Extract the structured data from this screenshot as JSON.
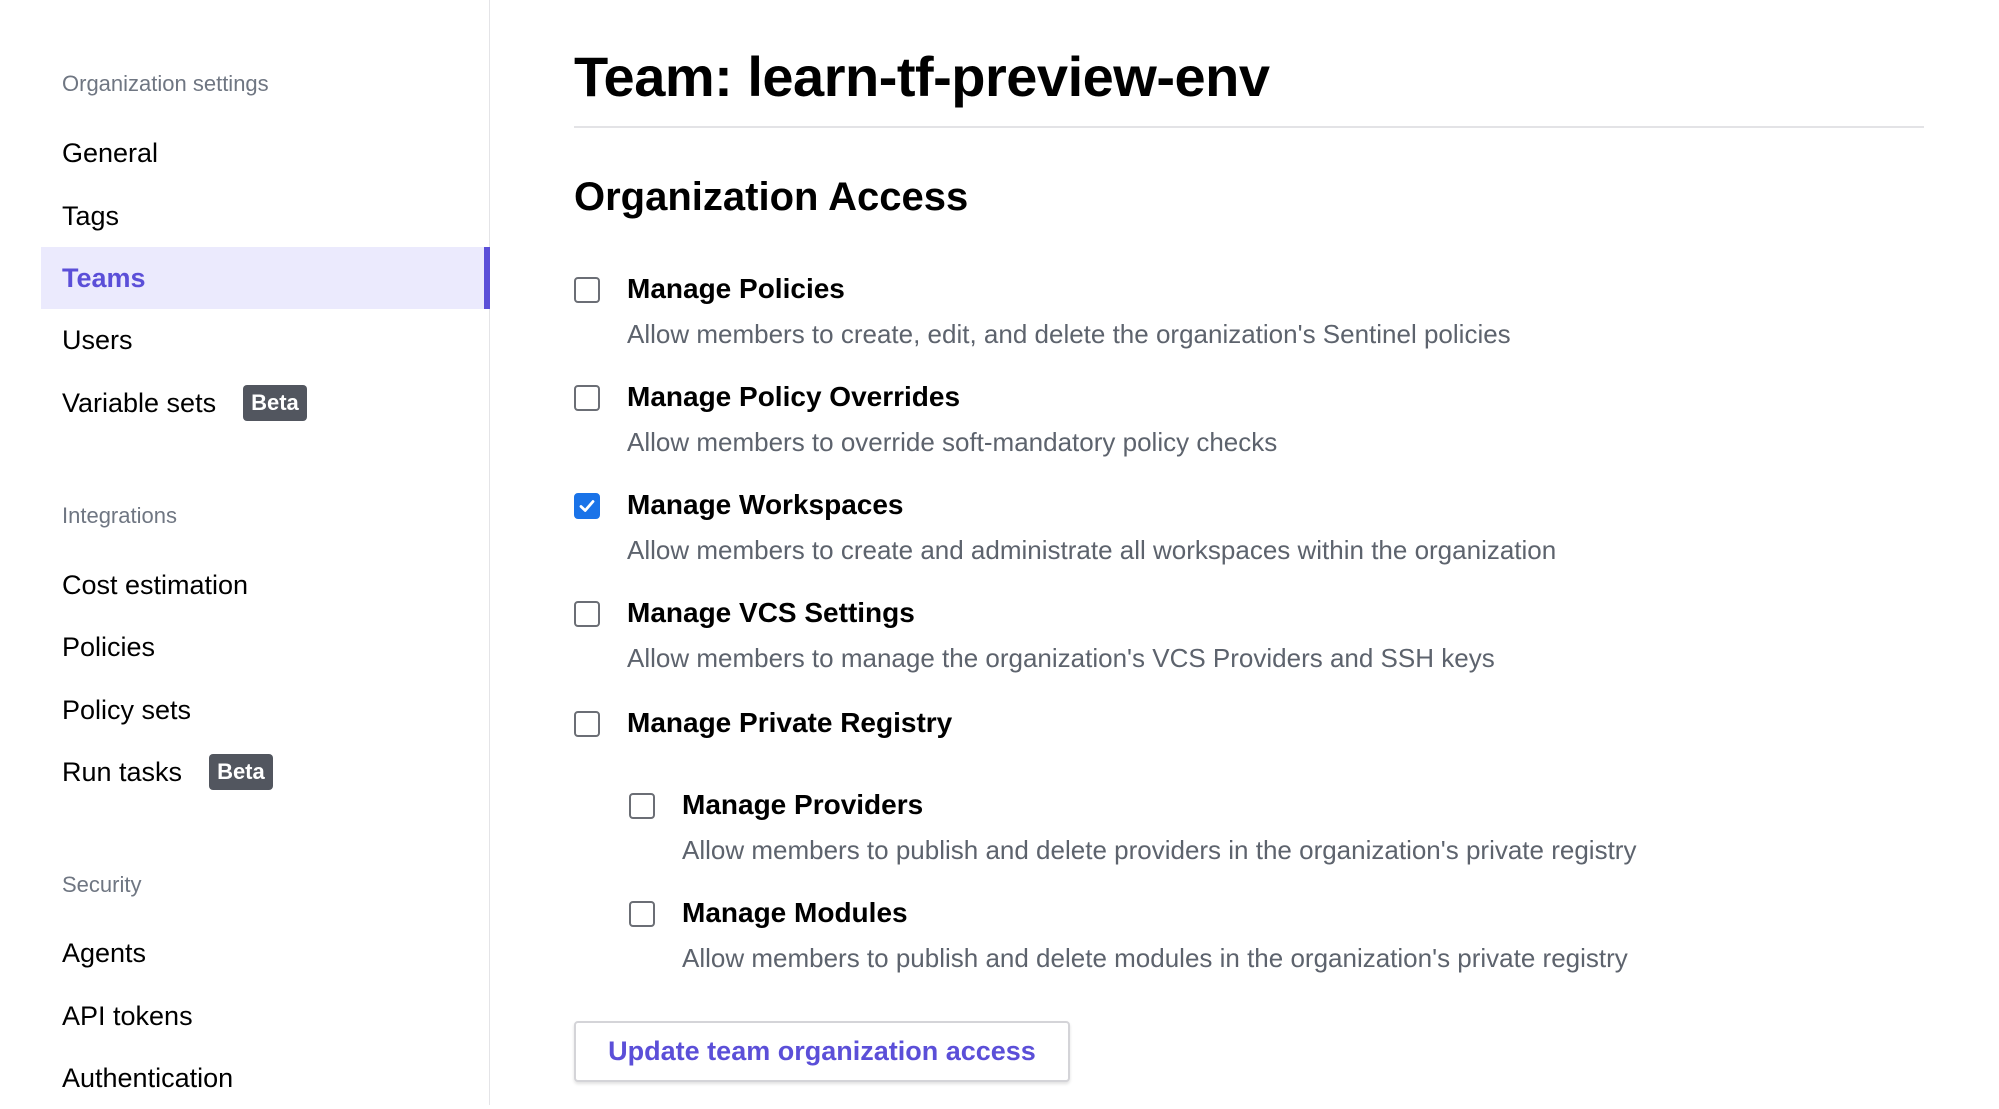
{
  "sidebar": {
    "sections": [
      {
        "title": "Organization settings",
        "items": [
          {
            "label": "General"
          },
          {
            "label": "Tags"
          },
          {
            "label": "Teams",
            "active": true
          },
          {
            "label": "Users"
          },
          {
            "label": "Variable sets",
            "badge": "Beta"
          }
        ]
      },
      {
        "title": "Integrations",
        "items": [
          {
            "label": "Cost estimation"
          },
          {
            "label": "Policies"
          },
          {
            "label": "Policy sets"
          },
          {
            "label": "Run tasks",
            "badge": "Beta"
          }
        ]
      },
      {
        "title": "Security",
        "items": [
          {
            "label": "Agents"
          },
          {
            "label": "API tokens"
          },
          {
            "label": "Authentication"
          }
        ]
      }
    ]
  },
  "main": {
    "title": "Team: learn-tf-preview-env",
    "section_title": "Organization Access",
    "permissions": [
      {
        "label": "Manage Policies",
        "description": "Allow members to create, edit, and delete the organization's Sentinel policies",
        "checked": false
      },
      {
        "label": "Manage Policy Overrides",
        "description": "Allow members to override soft-mandatory policy checks",
        "checked": false
      },
      {
        "label": "Manage Workspaces",
        "description": "Allow members to create and administrate all workspaces within the organization",
        "checked": true
      },
      {
        "label": "Manage VCS Settings",
        "description": "Allow members to manage the organization's VCS Providers and SSH keys",
        "checked": false
      },
      {
        "label": "Manage Private Registry",
        "description": "",
        "checked": false
      },
      {
        "label": "Manage Providers",
        "description": "Allow members to publish and delete providers in the organization's private registry",
        "checked": false
      },
      {
        "label": "Manage Modules",
        "description": "Allow members to publish and delete modules in the organization's private registry",
        "checked": false
      }
    ],
    "update_button_label": "Update team organization access"
  },
  "colors": {
    "accent": "#5b4fd8",
    "active_background": "#ebeafd",
    "checkbox_checked": "#1a73e8",
    "badge_background": "#52565f",
    "muted_text": "#6f7682"
  }
}
